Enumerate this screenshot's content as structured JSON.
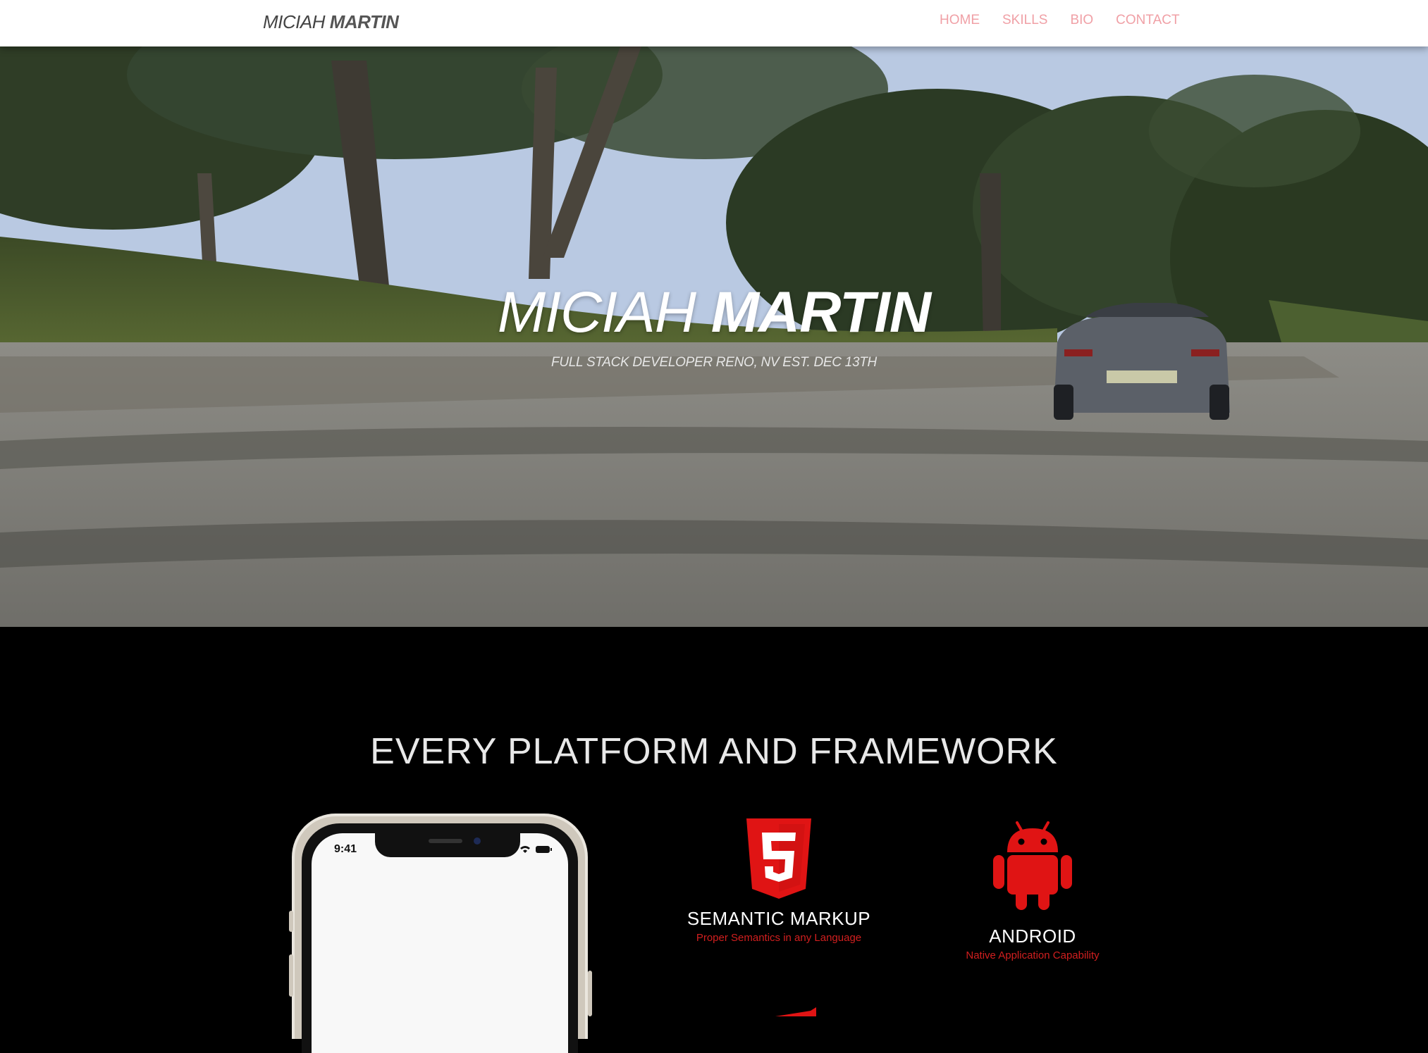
{
  "header": {
    "logo_first": "MICIAH",
    "logo_last": "MARTIN",
    "nav": [
      {
        "label": "HOME"
      },
      {
        "label": "SKILLS"
      },
      {
        "label": "BIO"
      },
      {
        "label": "CONTACT"
      }
    ]
  },
  "hero": {
    "title_first": "MICIAH",
    "title_last": "MARTIN",
    "subtitle": "FULL STACK DEVELOPER RENO, NV EST. DEC 13TH"
  },
  "platforms": {
    "heading": "EVERY PLATFORM AND FRAMEWORK",
    "phone_time": "9:41",
    "features": [
      {
        "title": "SEMANTIC MARKUP",
        "subtitle": "Proper Semantics in any Language",
        "icon": "html5-icon"
      },
      {
        "title": "ANDROID",
        "subtitle": "Native Application Capability",
        "icon": "android-icon"
      }
    ]
  },
  "colors": {
    "nav_link": "#f0a0a6",
    "accent_red": "#e01414",
    "background": "#000000"
  }
}
